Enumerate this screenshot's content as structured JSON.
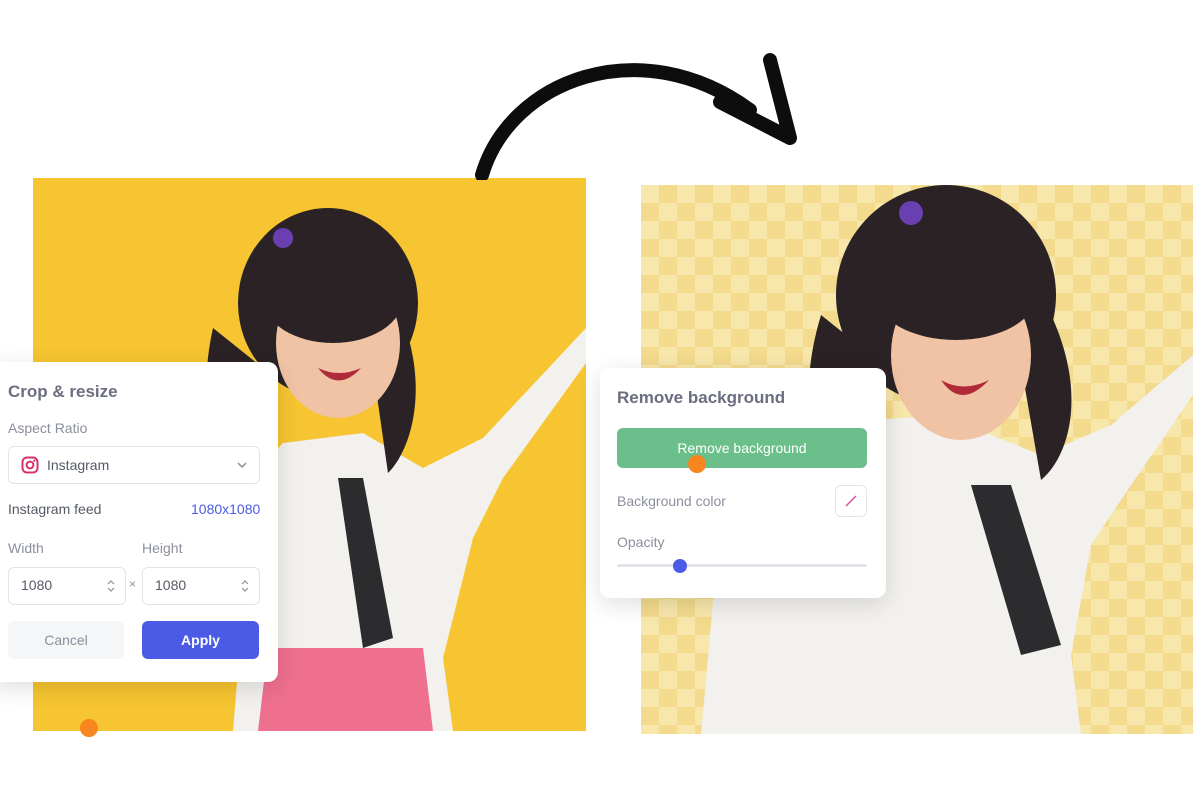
{
  "crop_panel": {
    "title": "Crop & resize",
    "aspect_ratio_label": "Aspect Ratio",
    "aspect_ratio_value": "Instagram",
    "preset_name": "Instagram feed",
    "preset_size": "1080x1080",
    "width_label": "Width",
    "height_label": "Height",
    "width_value": "1080",
    "height_value": "1080",
    "times_sign": "×",
    "cancel_label": "Cancel",
    "apply_label": "Apply"
  },
  "bg_panel": {
    "title": "Remove background",
    "button_label": "Remove background",
    "color_label": "Background color",
    "opacity_label": "Opacity",
    "opacity_value": 0.25
  },
  "colors": {
    "accent": "#4b5be6",
    "green": "#6abf8a",
    "yellow": "#f6c531",
    "cursor": "#f7861e"
  },
  "icons": [
    "instagram-icon",
    "chevron-down-icon",
    "stepper-icon",
    "no-color-icon",
    "curved-arrow-icon"
  ]
}
